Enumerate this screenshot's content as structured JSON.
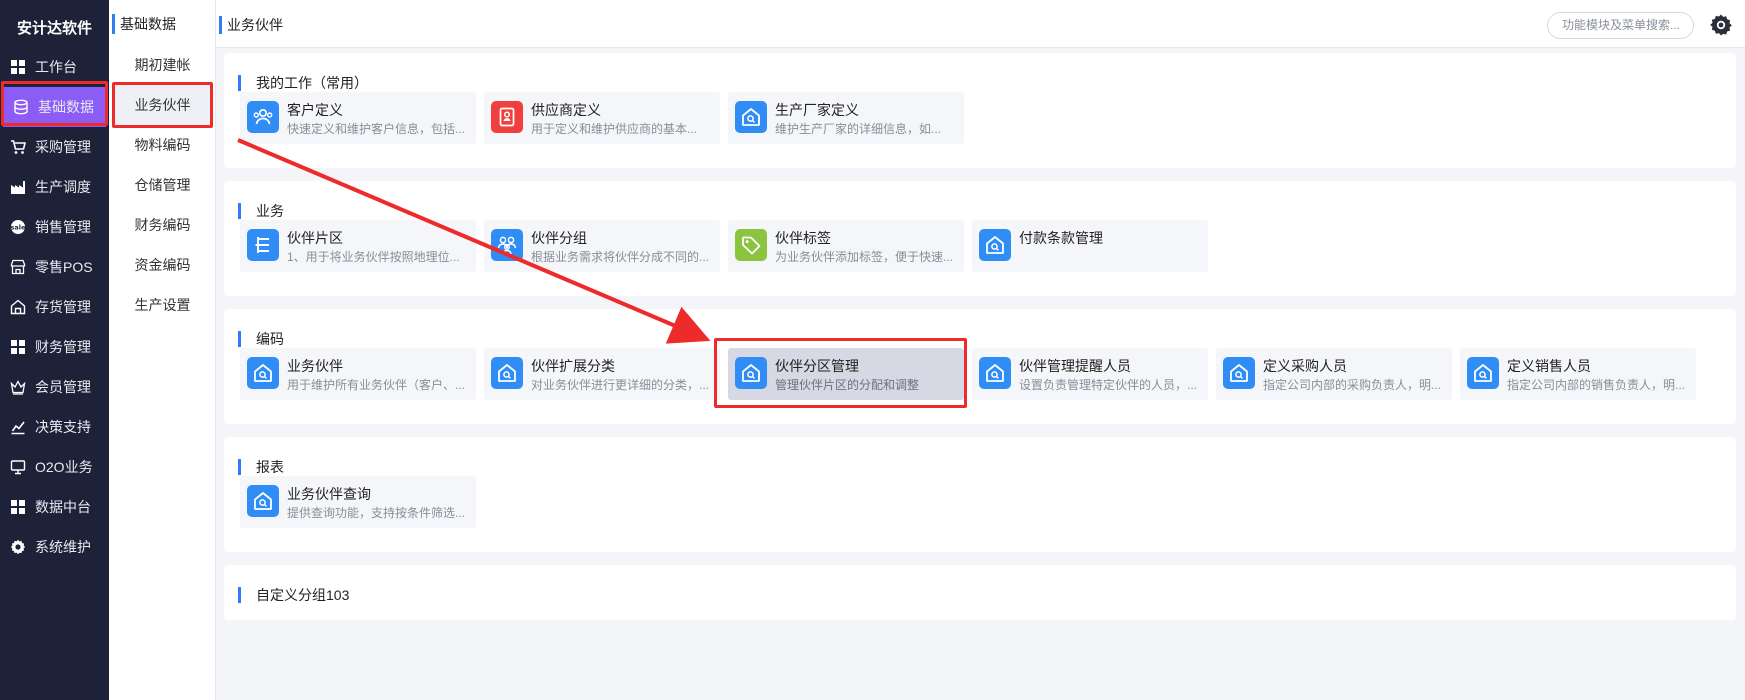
{
  "brand": "安计达软件",
  "nav": [
    {
      "label": "工作台",
      "icon": "grid-icon"
    },
    {
      "label": "基础数据",
      "icon": "database-icon",
      "active": true
    },
    {
      "label": "采购管理",
      "icon": "cart-icon"
    },
    {
      "label": "生产调度",
      "icon": "factory-icon"
    },
    {
      "label": "销售管理",
      "icon": "sale-icon"
    },
    {
      "label": "零售POS",
      "icon": "store-icon"
    },
    {
      "label": "存货管理",
      "icon": "warehouse-icon"
    },
    {
      "label": "财务管理",
      "icon": "grid-icon"
    },
    {
      "label": "会员管理",
      "icon": "crown-icon"
    },
    {
      "label": "决策支持",
      "icon": "chart-icon"
    },
    {
      "label": "O2O业务",
      "icon": "monitor-icon"
    },
    {
      "label": "数据中台",
      "icon": "grid-icon"
    },
    {
      "label": "系统维护",
      "icon": "gear-icon"
    }
  ],
  "submenu": {
    "title": "基础数据",
    "items": [
      {
        "label": "期初建帐"
      },
      {
        "label": "业务伙伴",
        "active": true
      },
      {
        "label": "物料编码"
      },
      {
        "label": "仓储管理"
      },
      {
        "label": "财务编码"
      },
      {
        "label": "资金编码"
      },
      {
        "label": "生产设置"
      }
    ]
  },
  "topbar": {
    "title": "业务伙伴",
    "search_placeholder": "功能模块及菜单搜索..."
  },
  "sections": [
    {
      "title": "我的工作（常用）",
      "cards": [
        {
          "title": "客户定义",
          "desc": "快速定义和维护客户信息，包括...",
          "icon": "customers-icon",
          "color": "#2f8df5"
        },
        {
          "title": "供应商定义",
          "desc": "用于定义和维护供应商的基本...",
          "icon": "supplier-icon",
          "color": "#ef3f3f"
        },
        {
          "title": "生产厂家定义",
          "desc": "维护生产厂家的详细信息，如...",
          "icon": "house-icon",
          "color": "#2f8df5"
        }
      ]
    },
    {
      "title": "业务",
      "cards": [
        {
          "title": "伙伴片区",
          "desc": "1、用于将业务伙伴按照地理位...",
          "icon": "list-tree-icon",
          "color": "#2f8df5"
        },
        {
          "title": "伙伴分组",
          "desc": "根据业务需求将伙伴分成不同的...",
          "icon": "group-icon",
          "color": "#2f8df5"
        },
        {
          "title": "伙伴标签",
          "desc": "为业务伙伴添加标签，便于快速...",
          "icon": "tag-icon",
          "color": "#8bc43f"
        },
        {
          "title": "付款条款管理",
          "desc": "",
          "icon": "house-icon",
          "color": "#2f8df5"
        }
      ]
    },
    {
      "title": "编码",
      "cards": [
        {
          "title": "业务伙伴",
          "desc": "用于维护所有业务伙伴（客户、...",
          "icon": "house-icon",
          "color": "#2f8df5"
        },
        {
          "title": "伙伴扩展分类",
          "desc": "对业务伙伴进行更详细的分类，...",
          "icon": "house-icon",
          "color": "#2f8df5"
        },
        {
          "title": "伙伴分区管理",
          "desc": "管理伙伴片区的分配和调整",
          "icon": "house-icon",
          "color": "#2f8df5",
          "selected": true
        },
        {
          "title": "伙伴管理提醒人员",
          "desc": "设置负责管理特定伙伴的人员，...",
          "icon": "house-icon",
          "color": "#2f8df5"
        },
        {
          "title": "定义采购人员",
          "desc": "指定公司内部的采购负责人，明...",
          "icon": "house-icon",
          "color": "#2f8df5"
        },
        {
          "title": "定义销售人员",
          "desc": "指定公司内部的销售负责人，明...",
          "icon": "house-icon",
          "color": "#2f8df5"
        }
      ]
    },
    {
      "title": "报表",
      "cards": [
        {
          "title": "业务伙伴查询",
          "desc": "提供查询功能，支持按条件筛选...",
          "icon": "house-icon",
          "color": "#2f8df5"
        }
      ]
    },
    {
      "title": "自定义分组103",
      "cards": []
    }
  ]
}
